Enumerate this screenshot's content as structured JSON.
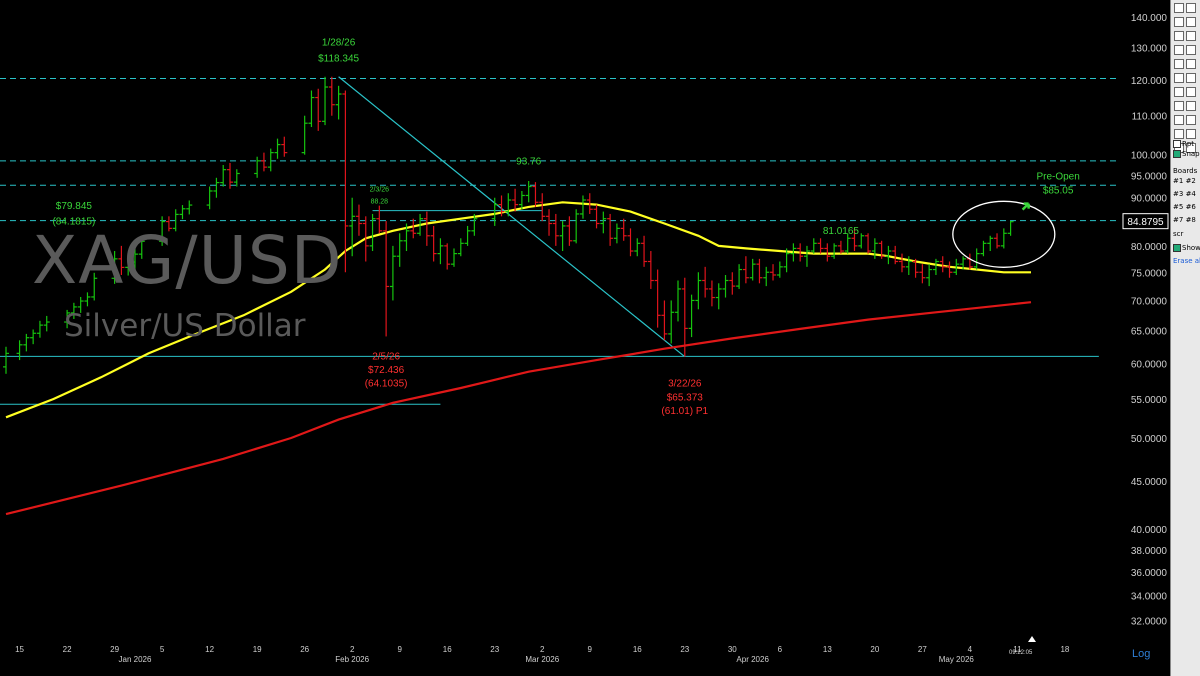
{
  "instrument": {
    "symbol": "XAG/USD",
    "description": "Silver/US Dollar"
  },
  "scale_mode": "Log",
  "time_readout": "09:22:05",
  "toolbar": {
    "rpt_label": "Rpt",
    "snap_label": "Snap",
    "boards_label": "Boards",
    "boards": [
      "#1",
      "#2",
      "#3",
      "#4",
      "#5",
      "#6",
      "#7",
      "#8"
    ],
    "scr_label": "scr",
    "show_label": "Show",
    "erase_label": "Erase all"
  },
  "colors": {
    "up": "#16c40e",
    "down": "#e0141c",
    "sma_fast": "#ffff22",
    "sma_slow": "#e01818",
    "lines": "#2ac3c8",
    "text_green": "#3ad63a",
    "text_red": "#ff3030"
  },
  "chart_data": {
    "type": "candlestick",
    "ylim": [
      30.5,
      146
    ],
    "log_scale": true,
    "grid": false,
    "y_ticks": [
      "140.000",
      "130.000",
      "120.000",
      "110.000",
      "100.000",
      "95.0000",
      "90.0000",
      "80.0000",
      "75.0000",
      "70.0000",
      "65.0000",
      "60.0000",
      "55.0000",
      "50.0000",
      "45.0000",
      "40.0000",
      "38.0000",
      "36.0000",
      "34.0000",
      "32.0000"
    ],
    "y_tick_values": [
      140,
      130,
      120,
      110,
      100,
      95,
      90,
      80,
      75,
      70,
      65,
      60,
      55,
      50,
      45,
      40,
      38,
      36,
      34,
      32
    ],
    "current_price_label": "84.8795",
    "current_price": 84.88,
    "x_ticks": [
      {
        "label": "15",
        "day": 15
      },
      {
        "label": "22",
        "day": 22
      },
      {
        "label": "29",
        "day": 29
      },
      {
        "label": "5",
        "day": 36
      },
      {
        "label": "12",
        "day": 43
      },
      {
        "label": "19",
        "day": 50
      },
      {
        "label": "26",
        "day": 57
      },
      {
        "label": "2",
        "day": 64
      },
      {
        "label": "9",
        "day": 71
      },
      {
        "label": "16",
        "day": 78
      },
      {
        "label": "23",
        "day": 85
      },
      {
        "label": "2",
        "day": 92
      },
      {
        "label": "9",
        "day": 99
      },
      {
        "label": "16",
        "day": 106
      },
      {
        "label": "23",
        "day": 113
      },
      {
        "label": "30",
        "day": 120
      },
      {
        "label": "6",
        "day": 127
      },
      {
        "label": "13",
        "day": 134
      },
      {
        "label": "20",
        "day": 141
      },
      {
        "label": "27",
        "day": 148
      },
      {
        "label": "4",
        "day": 155
      },
      {
        "label": "11",
        "day": 162
      },
      {
        "label": "18",
        "day": 169
      }
    ],
    "month_labels": [
      {
        "label": "Jan 2026",
        "day": 32
      },
      {
        "label": "Feb 2026",
        "day": 64
      },
      {
        "label": "Mar 2026",
        "day": 92
      },
      {
        "label": "Apr 2026",
        "day": 123
      },
      {
        "label": "May 2026",
        "day": 153
      }
    ],
    "x_day_range": [
      13,
      178
    ],
    "candles": [
      [
        13,
        59.5,
        62.5,
        58.5,
        61.5
      ],
      [
        15,
        61.5,
        63.5,
        60.5,
        62.8
      ],
      [
        16,
        62.8,
        64.5,
        61.8,
        63.9
      ],
      [
        17,
        63.9,
        65.2,
        62.9,
        64.6
      ],
      [
        18,
        64.6,
        66.6,
        63.9,
        65.9
      ],
      [
        19,
        65.9,
        67.4,
        64.9,
        66.4
      ],
      [
        22,
        66.4,
        68.4,
        65.4,
        67.9
      ],
      [
        23,
        67.9,
        69.6,
        66.9,
        68.9
      ],
      [
        24,
        68.9,
        70.6,
        67.9,
        69.9
      ],
      [
        25,
        69.9,
        71.4,
        69.0,
        70.6
      ],
      [
        26,
        70.6,
        74.9,
        70.0,
        73.9
      ],
      [
        29,
        73.9,
        79.0,
        72.9,
        77.5
      ],
      [
        30,
        77.5,
        80.0,
        74.5,
        75.9
      ],
      [
        31,
        75.9,
        77.9,
        74.4,
        76.9
      ],
      [
        32,
        76.9,
        79.4,
        75.5,
        78.4
      ],
      [
        33,
        78.4,
        82.0,
        77.5,
        80.9
      ],
      [
        36,
        80.9,
        86.0,
        80.0,
        84.9
      ],
      [
        37,
        84.9,
        86.0,
        82.9,
        83.5
      ],
      [
        38,
        83.5,
        87.5,
        82.9,
        86.4
      ],
      [
        39,
        86.4,
        88.4,
        85.4,
        87.6
      ],
      [
        40,
        87.6,
        89.4,
        86.4,
        88.4
      ],
      [
        43,
        88.4,
        92.5,
        87.5,
        91.5
      ],
      [
        44,
        91.5,
        94.5,
        90.0,
        93.4
      ],
      [
        45,
        93.4,
        97.5,
        92.5,
        96.4
      ],
      [
        46,
        96.4,
        98.0,
        92.0,
        93.5
      ],
      [
        47,
        93.5,
        96.5,
        92.5,
        95.5
      ],
      [
        50,
        95.5,
        99.5,
        94.5,
        98.5
      ],
      [
        51,
        98.5,
        100.5,
        96.0,
        97.0
      ],
      [
        52,
        97.0,
        101.5,
        96.0,
        100.5
      ],
      [
        53,
        100.5,
        104.0,
        99.0,
        102.5
      ],
      [
        54,
        102.5,
        104.5,
        99.5,
        100.5
      ],
      [
        57,
        100.5,
        110.0,
        100.0,
        108.0
      ],
      [
        58,
        108.0,
        117.0,
        107.0,
        115.0
      ],
      [
        59,
        115.0,
        117.5,
        106.0,
        108.5
      ],
      [
        60,
        108.5,
        121.0,
        107.5,
        118.0
      ],
      [
        61,
        118.0,
        121.0,
        110.0,
        113.0
      ],
      [
        62,
        113.0,
        118.345,
        109.0,
        116.0
      ],
      [
        63,
        116.0,
        117.0,
        75.0,
        84.0
      ],
      [
        64,
        84.0,
        90.0,
        78.0,
        86.0
      ],
      [
        65,
        86.0,
        88.5,
        82.0,
        84.5
      ],
      [
        66,
        84.5,
        86.0,
        77.0,
        80.0
      ],
      [
        67,
        80.0,
        86.5,
        79.0,
        85.5
      ],
      [
        68,
        85.5,
        88.28,
        82.5,
        83.0
      ],
      [
        69,
        83.0,
        85.0,
        64.1,
        72.436
      ],
      [
        70,
        72.436,
        80.0,
        70.0,
        78.0
      ],
      [
        71,
        78.0,
        82.5,
        76.0,
        81.0
      ],
      [
        72,
        81.0,
        84.5,
        79.0,
        83.0
      ],
      [
        73,
        83.0,
        85.5,
        81.5,
        82.5
      ],
      [
        74,
        82.5,
        86.5,
        82.0,
        85.5
      ],
      [
        75,
        85.5,
        87.0,
        80.0,
        82.0
      ],
      [
        76,
        82.0,
        84.0,
        77.0,
        78.5
      ],
      [
        77,
        78.5,
        81.5,
        76.5,
        80.0
      ],
      [
        78,
        80.0,
        80.5,
        75.5,
        76.5
      ],
      [
        79,
        76.5,
        79.5,
        76.0,
        78.5
      ],
      [
        80,
        78.5,
        81.5,
        78.0,
        80.5
      ],
      [
        81,
        80.5,
        84.0,
        80.0,
        83.0
      ],
      [
        82,
        83.0,
        86.5,
        82.0,
        85.5
      ],
      [
        85,
        85.5,
        90.0,
        84.0,
        88.5
      ],
      [
        86,
        88.5,
        90.5,
        86.0,
        87.0
      ],
      [
        87,
        87.0,
        91.0,
        86.0,
        89.5
      ],
      [
        88,
        89.5,
        92.0,
        87.0,
        88.5
      ],
      [
        89,
        88.5,
        91.5,
        87.5,
        90.5
      ],
      [
        90,
        90.5,
        93.76,
        89.0,
        92.5
      ],
      [
        91,
        92.5,
        93.5,
        88.0,
        89.0
      ],
      [
        92,
        89.0,
        91.0,
        85.0,
        86.0
      ],
      [
        93,
        86.0,
        87.5,
        82.0,
        84.5
      ],
      [
        94,
        84.5,
        86.5,
        80.0,
        82.0
      ],
      [
        95,
        82.0,
        85.0,
        79.0,
        84.0
      ],
      [
        96,
        84.0,
        86.0,
        80.0,
        81.0
      ],
      [
        97,
        81.0,
        87.5,
        80.5,
        86.5
      ],
      [
        98,
        86.5,
        90.5,
        85.5,
        89.5
      ],
      [
        99,
        89.5,
        91.0,
        86.5,
        87.5
      ],
      [
        100,
        87.5,
        88.5,
        83.5,
        84.5
      ],
      [
        101,
        84.5,
        87.0,
        82.5,
        85.5
      ],
      [
        102,
        85.5,
        86.5,
        80.0,
        81.5
      ],
      [
        103,
        81.5,
        84.5,
        80.5,
        83.5
      ],
      [
        104,
        83.5,
        85.5,
        81.0,
        82.0
      ],
      [
        105,
        82.0,
        83.5,
        78.0,
        79.0
      ],
      [
        106,
        79.0,
        81.5,
        78.0,
        80.5
      ],
      [
        107,
        80.5,
        82.0,
        76.0,
        77.0
      ],
      [
        108,
        77.0,
        79.0,
        72.0,
        73.5
      ],
      [
        109,
        73.5,
        75.5,
        65.5,
        67.5
      ],
      [
        110,
        67.5,
        70.0,
        63.5,
        64.5
      ],
      [
        111,
        64.5,
        70.0,
        63.0,
        68.0
      ],
      [
        112,
        68.0,
        73.5,
        66.5,
        72.0
      ],
      [
        113,
        72.0,
        74.0,
        61.01,
        65.373
      ],
      [
        114,
        65.373,
        71.0,
        64.0,
        70.0
      ],
      [
        115,
        70.0,
        75.0,
        68.5,
        73.5
      ],
      [
        116,
        73.5,
        76.0,
        70.5,
        72.0
      ],
      [
        117,
        72.0,
        73.5,
        69.0,
        70.5
      ],
      [
        118,
        70.5,
        73.0,
        68.5,
        72.0
      ],
      [
        119,
        72.0,
        74.5,
        70.5,
        73.5
      ],
      [
        120,
        73.5,
        75.0,
        71.0,
        72.5
      ],
      [
        121,
        72.5,
        76.5,
        72.0,
        75.5
      ],
      [
        122,
        75.5,
        78.0,
        73.0,
        74.0
      ],
      [
        123,
        74.0,
        77.5,
        73.5,
        76.5
      ],
      [
        124,
        76.5,
        77.5,
        73.0,
        74.0
      ],
      [
        125,
        74.0,
        76.0,
        72.5,
        75.0
      ],
      [
        126,
        75.0,
        76.5,
        73.5,
        74.5
      ],
      [
        127,
        74.5,
        77.0,
        74.0,
        76.0
      ],
      [
        128,
        76.0,
        79.5,
        75.0,
        78.5
      ],
      [
        129,
        78.5,
        80.5,
        77.0,
        79.5
      ],
      [
        130,
        79.5,
        80.5,
        77.0,
        78.0
      ],
      [
        131,
        78.0,
        80.0,
        76.0,
        79.0
      ],
      [
        132,
        79.0,
        81.5,
        78.5,
        80.5
      ],
      [
        133,
        80.5,
        81.5,
        78.5,
        79.5
      ],
      [
        134,
        79.5,
        80.5,
        77.0,
        78.0
      ],
      [
        135,
        78.0,
        80.5,
        77.5,
        80.0
      ],
      [
        136,
        80.0,
        81.0,
        78.5,
        79.0
      ],
      [
        137,
        79.0,
        82.5,
        78.5,
        81.5
      ],
      [
        138,
        81.5,
        83.5,
        79.0,
        80.0
      ],
      [
        139,
        80.0,
        82.5,
        79.5,
        82.0
      ],
      [
        140,
        82.0,
        82.5,
        78.5,
        79.0
      ],
      [
        141,
        79.0,
        81.5,
        77.5,
        80.5
      ],
      [
        142,
        80.5,
        81.0,
        77.5,
        78.0
      ],
      [
        143,
        78.0,
        80.0,
        76.5,
        79.0
      ],
      [
        144,
        79.0,
        80.0,
        76.5,
        77.0
      ],
      [
        145,
        77.0,
        78.5,
        75.0,
        76.0
      ],
      [
        146,
        76.0,
        78.0,
        74.5,
        77.0
      ],
      [
        147,
        77.0,
        77.5,
        74.0,
        75.0
      ],
      [
        148,
        75.0,
        76.5,
        73.0,
        74.0
      ],
      [
        149,
        74.0,
        76.5,
        72.5,
        75.5
      ],
      [
        150,
        75.5,
        77.5,
        74.5,
        77.0
      ],
      [
        151,
        77.0,
        78.0,
        75.0,
        76.0
      ],
      [
        152,
        76.0,
        77.0,
        74.0,
        75.0
      ],
      [
        153,
        75.0,
        77.5,
        74.5,
        76.5
      ],
      [
        154,
        76.5,
        78.0,
        75.5,
        77.5
      ],
      [
        155,
        77.5,
        78.5,
        75.5,
        76.0
      ],
      [
        156,
        76.0,
        79.5,
        75.5,
        78.5
      ],
      [
        157,
        78.5,
        81.0,
        78.0,
        80.5
      ],
      [
        158,
        80.5,
        82.0,
        79.0,
        81.5
      ],
      [
        159,
        81.5,
        82.5,
        79.5,
        80.0
      ],
      [
        160,
        80.0,
        83.5,
        79.5,
        82.5
      ],
      [
        161,
        82.5,
        85.05,
        82.0,
        84.88
      ]
    ],
    "sma_fast": [
      [
        13,
        52.6
      ],
      [
        20,
        55.0
      ],
      [
        27,
        58.0
      ],
      [
        34,
        61.5
      ],
      [
        41,
        64.5
      ],
      [
        48,
        67.5
      ],
      [
        55,
        71.5
      ],
      [
        60,
        75.5
      ],
      [
        63,
        79.0
      ],
      [
        66,
        81.5
      ],
      [
        70,
        83.0
      ],
      [
        75,
        84.5
      ],
      [
        80,
        85.5
      ],
      [
        85,
        86.5
      ],
      [
        90,
        88.0
      ],
      [
        95,
        89.0
      ],
      [
        100,
        88.5
      ],
      [
        105,
        87.0
      ],
      [
        110,
        84.5
      ],
      [
        115,
        82.0
      ],
      [
        118,
        80.0
      ],
      [
        122,
        79.5
      ],
      [
        127,
        79.0
      ],
      [
        132,
        78.5
      ],
      [
        136,
        78.5
      ],
      [
        140,
        78.5
      ],
      [
        143,
        78.0
      ],
      [
        147,
        77.0
      ],
      [
        152,
        76.0
      ],
      [
        156,
        75.5
      ],
      [
        160,
        75.0
      ],
      [
        164,
        75.0
      ]
    ],
    "sma_slow": [
      [
        13,
        41.5
      ],
      [
        30,
        44.5
      ],
      [
        45,
        47.5
      ],
      [
        55,
        50.0
      ],
      [
        62,
        52.3
      ],
      [
        70,
        54.5
      ],
      [
        80,
        56.5
      ],
      [
        90,
        58.8
      ],
      [
        100,
        60.5
      ],
      [
        110,
        62.2
      ],
      [
        120,
        63.8
      ],
      [
        130,
        65.3
      ],
      [
        140,
        66.8
      ],
      [
        150,
        68.0
      ],
      [
        164,
        69.7
      ]
    ],
    "trendline": [
      [
        62,
        121.0
      ],
      [
        113,
        61.0
      ]
    ],
    "h_dashed": [
      120.5,
      98.5,
      92.8,
      85.1
    ],
    "h_solid": [
      {
        "y": 61.05,
        "x1": 13,
        "x2": 174
      },
      {
        "y": 54.3,
        "x1": 13,
        "x2": 77
      },
      {
        "y": 87.2,
        "x1": 67,
        "x2": 92
      }
    ],
    "annotations": [
      {
        "text": "1/28/26",
        "day": 62,
        "price": 130.6,
        "color": "green",
        "size": 10
      },
      {
        "text": "$118.345",
        "day": 62,
        "price": 125.6,
        "color": "green",
        "size": 10
      },
      {
        "text": "93.76",
        "day": 90,
        "price": 97.6,
        "color": "green",
        "size": 10
      },
      {
        "text": "2/3/26",
        "day": 68,
        "price": 91.4,
        "color": "green",
        "size": 7
      },
      {
        "text": "88.28",
        "day": 68,
        "price": 88.7,
        "color": "green",
        "size": 7
      },
      {
        "text": "$79.845",
        "day": 23,
        "price": 87.6,
        "color": "green",
        "size": 10
      },
      {
        "text": "(84.1815)",
        "day": 23,
        "price": 84.3,
        "color": "green",
        "size": 10
      },
      {
        "text": "81.0165",
        "day": 136,
        "price": 82.4,
        "color": "green",
        "size": 10
      },
      {
        "text": "Pre-Open",
        "day": 168,
        "price": 94.1,
        "color": "green",
        "size": 10
      },
      {
        "text": "$85.05",
        "day": 168,
        "price": 90.9,
        "color": "green",
        "size": 10
      },
      {
        "text": "2/5/26",
        "day": 69,
        "price": 60.6,
        "color": "red",
        "size": 10
      },
      {
        "text": "$72.436",
        "day": 69,
        "price": 58.6,
        "color": "red",
        "size": 10
      },
      {
        "text": "(64.1035)",
        "day": 69,
        "price": 56.7,
        "color": "red",
        "size": 10
      },
      {
        "text": "3/22/26",
        "day": 113,
        "price": 56.7,
        "color": "red",
        "size": 10
      },
      {
        "text": "$65.373",
        "day": 113,
        "price": 54.8,
        "color": "red",
        "size": 10
      },
      {
        "text": "(61.01) P1",
        "day": 113,
        "price": 53.0,
        "color": "red",
        "size": 10
      }
    ],
    "ellipse": {
      "day": 160,
      "price": 82.3
    }
  }
}
